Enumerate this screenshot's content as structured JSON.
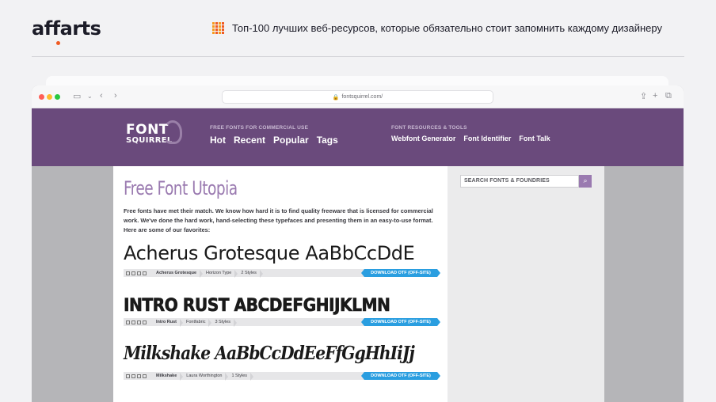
{
  "article": {
    "logo": "affarts",
    "headline": "Топ-100 лучших веб-ресурсов, которые обязательно стоит запомнить каждому дизайнеру"
  },
  "browser": {
    "url": "fontsquirrel.com/"
  },
  "site": {
    "logo_top": "FONT",
    "logo_bottom": "SQUIRREL",
    "nav_left_caption": "FREE FONTS FOR COMMERCIAL USE",
    "nav_left": [
      "Hot",
      "Recent",
      "Popular",
      "Tags"
    ],
    "nav_right_caption": "FONT RESOURCES & TOOLS",
    "nav_right": [
      "Webfont Generator",
      "Font Identifier",
      "Font Talk"
    ],
    "search_placeholder": "SEARCH FONTS & FOUNDRIES"
  },
  "main": {
    "title": "Free Font Utopia",
    "intro": "Free fonts have met their match. We know how hard it is to find quality freeware that is licensed for commercial work. We've done the hard work, hand-selecting these typefaces and presenting them in an easy-to-use format. Here are some of our favorites:",
    "download_label": "DOWNLOAD OTF (OFF-SITE)",
    "fonts": [
      {
        "sample": "Acherus Grotesque AaBbCcDdE",
        "name": "Acherus Grotesque",
        "foundry": "Horizon Type",
        "styles": "2 Styles"
      },
      {
        "sample": "INTRO RUST ABCDEFGHIJKLMN",
        "name": "Intro Rust",
        "foundry": "Fontfabric",
        "styles": "3 Styles"
      },
      {
        "sample": "Milkshake AaBbCcDdEeFfGgHhIiJj",
        "name": "Milkshake",
        "foundry": "Laura Worthington",
        "styles": "1 Styles"
      }
    ]
  },
  "colors": {
    "header": "#6a4a7c",
    "accent": "#9a7ab0",
    "download": "#2a9ee0",
    "brand_orange": "#f05a22"
  }
}
